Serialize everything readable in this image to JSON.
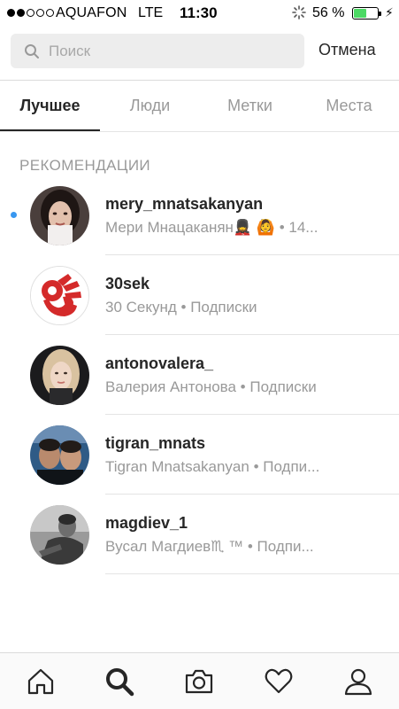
{
  "status_bar": {
    "carrier": "AQUAFON",
    "network": "LTE",
    "time": "11:30",
    "battery_percent": "56 %",
    "battery_level": 0.56,
    "signal_bars_filled": 2,
    "signal_bars_total": 5
  },
  "search": {
    "placeholder": "Поиск",
    "value": "",
    "cancel_label": "Отмена"
  },
  "tabs": [
    {
      "label": "Лучшее",
      "active": true
    },
    {
      "label": "Люди",
      "active": false
    },
    {
      "label": "Метки",
      "active": false
    },
    {
      "label": "Места",
      "active": false
    }
  ],
  "section": {
    "title": "РЕКОМЕНДАЦИИ"
  },
  "results": [
    {
      "username": "mery_mnatsakanyan",
      "subtitle": "Мери Мнацаканян💂‍♀️ 🙆 • 14...",
      "unread": true,
      "avatar": "woman-portrait"
    },
    {
      "username": "30sek",
      "subtitle": "30 Секунд • Подписки",
      "unread": false,
      "avatar": "ok-hand-logo"
    },
    {
      "username": "antonovalera_",
      "subtitle": "Валерия Антонова • Подписки",
      "unread": false,
      "avatar": "blonde-portrait"
    },
    {
      "username": "tigran_mnats",
      "subtitle": "Tigran Mnatsakanyan • Подпи...",
      "unread": false,
      "avatar": "two-men-portrait"
    },
    {
      "username": "magdiev_1",
      "subtitle": "Вусал Магдиев♏ ™ • Подпи...",
      "unread": false,
      "avatar": "bw-portrait"
    }
  ],
  "bottom_nav": [
    {
      "icon": "home-icon",
      "active": false
    },
    {
      "icon": "search-icon",
      "active": true
    },
    {
      "icon": "camera-icon",
      "active": false
    },
    {
      "icon": "heart-icon",
      "active": false
    },
    {
      "icon": "profile-icon",
      "active": false
    }
  ],
  "colors": {
    "accent_blue": "#3897f0",
    "battery_green": "#4cd964",
    "logo_red": "#d42a2a"
  }
}
